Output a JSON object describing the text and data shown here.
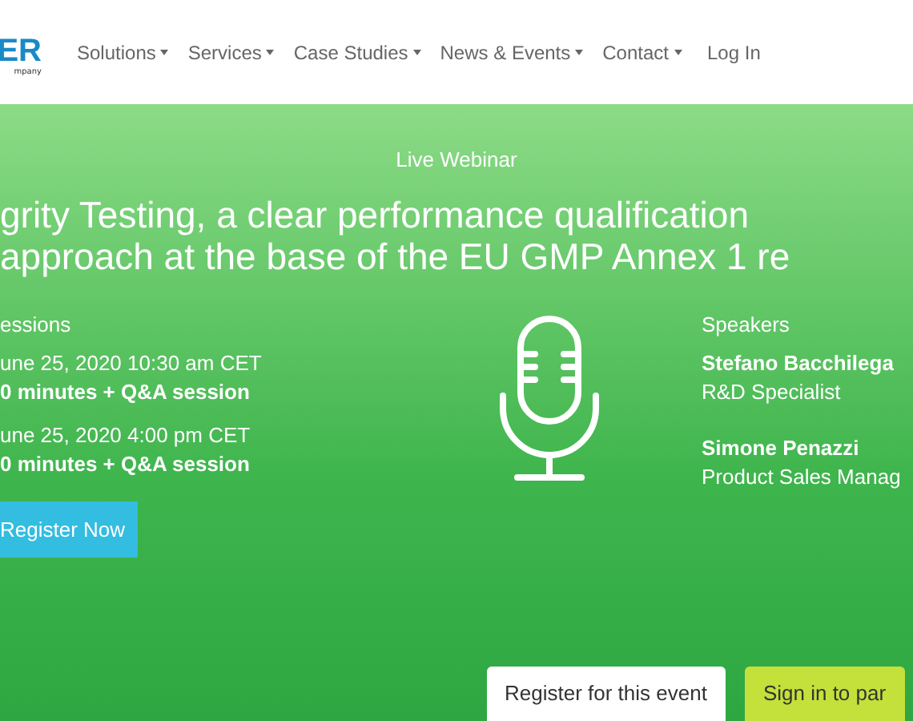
{
  "logo": {
    "mark": "ER",
    "tagline": "mpany"
  },
  "nav": [
    {
      "label": "Solutions",
      "dropdown": true
    },
    {
      "label": "Services",
      "dropdown": true
    },
    {
      "label": "Case Studies",
      "dropdown": true
    },
    {
      "label": "News & Events",
      "dropdown": true
    },
    {
      "label": "Contact",
      "dropdown": true
    },
    {
      "label": "Log In",
      "dropdown": false
    }
  ],
  "hero": {
    "eyebrow": "Live Webinar",
    "title_lines": [
      "grity Testing, a clear performance qualification",
      "approach at the base of the EU GMP Annex 1 re"
    ]
  },
  "sessions": {
    "heading": "essions",
    "items": [
      {
        "date": "une 25, 2020 10:30 am CET",
        "duration": "0 minutes + Q&A session"
      },
      {
        "date": "une 25, 2020 4:00 pm CET",
        "duration": "0 minutes + Q&A session"
      }
    ],
    "button": "Register Now"
  },
  "speakers": {
    "heading": "Speakers",
    "items": [
      {
        "name": "Stefano Bacchilega",
        "role": "R&D Specialist"
      },
      {
        "name": "Simone Penazzi",
        "role": "Product Sales Manag"
      }
    ]
  },
  "tabs": [
    {
      "label": "Register for this event",
      "selected": true
    },
    {
      "label": "Sign in to par",
      "selected": false
    }
  ]
}
